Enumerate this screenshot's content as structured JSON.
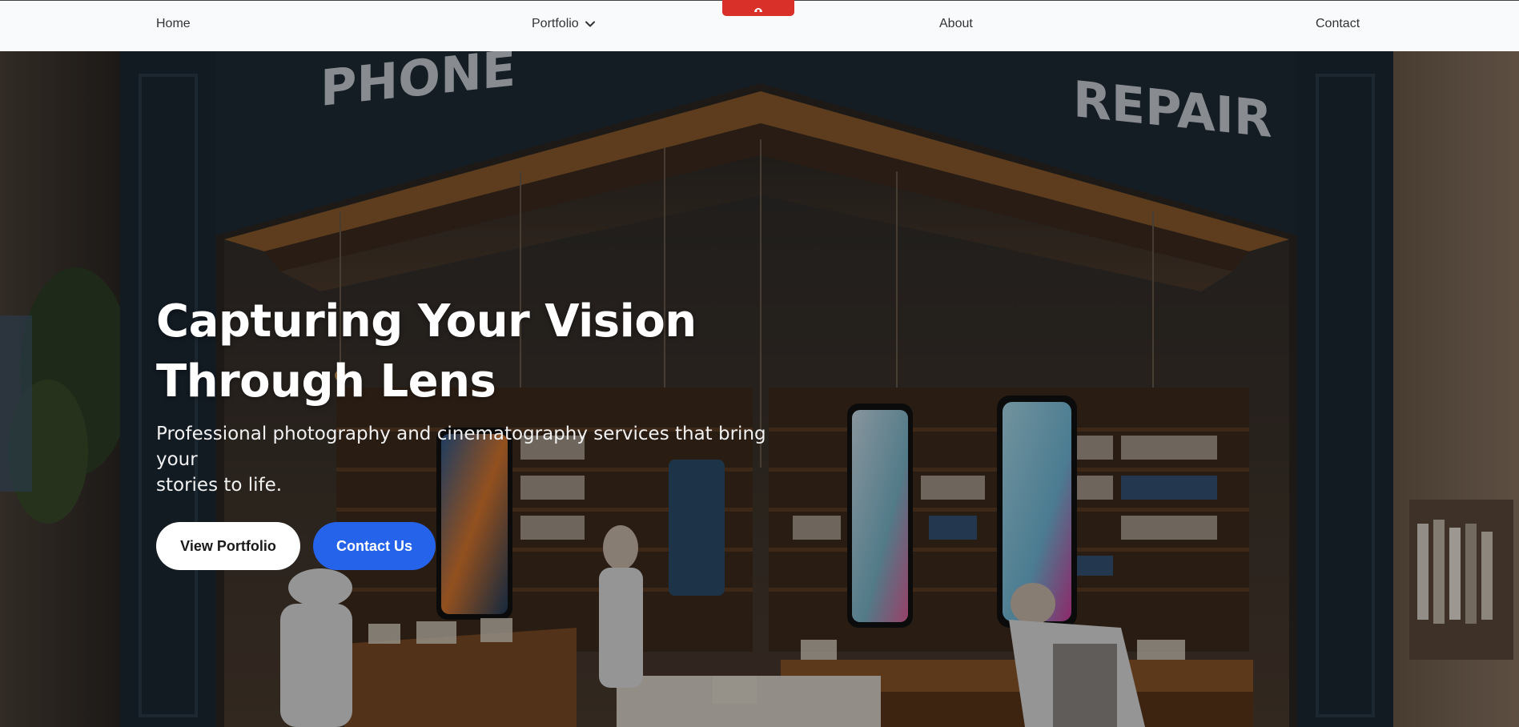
{
  "nav": {
    "home": "Home",
    "portfolio": "Portfolio",
    "about": "About",
    "contact": "Contact"
  },
  "hero": {
    "title_line1": "Capturing Your Vision",
    "title_line2": "Through Lens",
    "subtitle_line1": "Professional photography and cinematography services that bring your",
    "subtitle_line2": "stories to life.",
    "btn_portfolio": "View Portfolio",
    "btn_contact": "Contact Us",
    "background_sign_left": "PHONE",
    "background_sign_right": "REPAIR"
  },
  "colors": {
    "nav_bg": "#f8fafc",
    "record_tab": "#d9302a",
    "primary_button": "#2563eb"
  },
  "icons": {
    "portfolio_dropdown": "chevron-down-icon",
    "record_tab": "record-icon"
  }
}
